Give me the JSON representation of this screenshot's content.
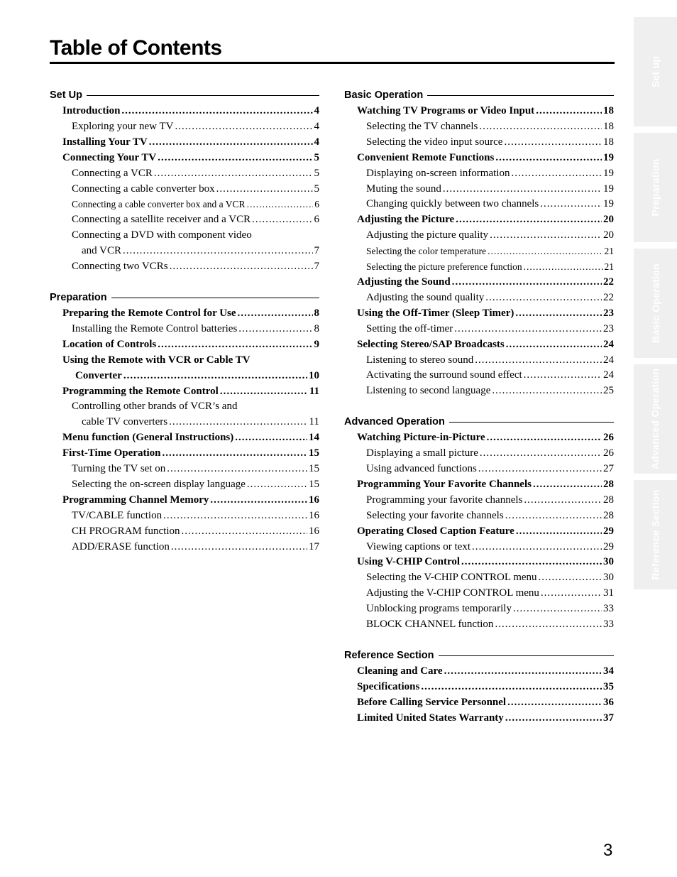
{
  "page": {
    "title": "Table of Contents",
    "page_number": "3"
  },
  "side_tabs": [
    {
      "label": "Set up"
    },
    {
      "label": "Preparation"
    },
    {
      "label": "Basic Operation"
    },
    {
      "label": "Advanced Operation"
    },
    {
      "label": "Reference Section"
    }
  ],
  "columns": [
    {
      "sections": [
        {
          "title": "Set Up",
          "entries": [
            {
              "level": 1,
              "label": "Introduction",
              "page": "4"
            },
            {
              "level": 2,
              "label": "Exploring your new TV",
              "page": "4"
            },
            {
              "level": 1,
              "label": "Installing Your TV",
              "page": "4"
            },
            {
              "level": 1,
              "label": "Connecting Your TV",
              "page": "5"
            },
            {
              "level": 2,
              "label": "Connecting a VCR",
              "page": "5"
            },
            {
              "level": 2,
              "label": "Connecting a cable converter box",
              "page": "5"
            },
            {
              "level": 2,
              "small": true,
              "label": "Connecting a cable converter box and a VCR",
              "page": "6"
            },
            {
              "level": 2,
              "label": "Connecting a satellite receiver and a VCR",
              "page": "6"
            },
            {
              "level": 2,
              "label": "Connecting a DVD with component video",
              "page": ""
            },
            {
              "level": 2,
              "cont": true,
              "label": "and VCR",
              "page": "7"
            },
            {
              "level": 2,
              "label": "Connecting two VCRs",
              "page": "7"
            }
          ]
        },
        {
          "title": "Preparation",
          "entries": [
            {
              "level": 1,
              "label": "Preparing the Remote Control for Use",
              "page": "8"
            },
            {
              "level": 2,
              "label": "Installing the Remote Control batteries",
              "page": "8"
            },
            {
              "level": 1,
              "label": "Location of Controls",
              "page": "9"
            },
            {
              "level": 1,
              "label": "Using the Remote with VCR or Cable TV",
              "page": ""
            },
            {
              "level": 1,
              "cont": true,
              "label": "Converter",
              "page": "10"
            },
            {
              "level": 1,
              "label": "Programming the Remote Control",
              "page": "11"
            },
            {
              "level": 2,
              "label": "Controlling other brands of VCR’s and",
              "page": ""
            },
            {
              "level": 2,
              "cont": true,
              "label": "cable TV converters",
              "page": "11"
            },
            {
              "level": 1,
              "label": "Menu function (General Instructions)",
              "page": "14"
            },
            {
              "level": 1,
              "label": "First-Time Operation",
              "page": "15"
            },
            {
              "level": 2,
              "label": "Turning the TV set on",
              "page": "15"
            },
            {
              "level": 2,
              "label": "Selecting the on-screen display language",
              "page": "15"
            },
            {
              "level": 1,
              "label": "Programming Channel Memory",
              "page": "16"
            },
            {
              "level": 2,
              "label": "TV/CABLE function",
              "page": "16"
            },
            {
              "level": 2,
              "label": "CH PROGRAM function",
              "page": "16"
            },
            {
              "level": 2,
              "label": "ADD/ERASE function",
              "page": "17"
            }
          ]
        }
      ]
    },
    {
      "sections": [
        {
          "title": "Basic Operation",
          "entries": [
            {
              "level": 1,
              "label": "Watching TV Programs or Video Input",
              "page": "18"
            },
            {
              "level": 2,
              "label": "Selecting the TV channels",
              "page": "18"
            },
            {
              "level": 2,
              "label": "Selecting the video input source",
              "page": "18"
            },
            {
              "level": 1,
              "label": "Convenient Remote Functions",
              "page": "19"
            },
            {
              "level": 2,
              "label": "Displaying on-screen information",
              "page": "19"
            },
            {
              "level": 2,
              "label": "Muting the sound",
              "page": "19"
            },
            {
              "level": 2,
              "label": "Changing quickly between two channels",
              "page": "19"
            },
            {
              "level": 1,
              "label": "Adjusting the Picture",
              "page": "20"
            },
            {
              "level": 2,
              "label": "Adjusting the picture quality",
              "page": "20"
            },
            {
              "level": 2,
              "small": true,
              "label": "Selecting the color temperature",
              "page": "21"
            },
            {
              "level": 2,
              "small": true,
              "label": "Selecting the picture preference function",
              "page": "21"
            },
            {
              "level": 1,
              "label": "Adjusting the Sound",
              "page": "22"
            },
            {
              "level": 2,
              "label": "Adjusting the sound quality",
              "page": "22"
            },
            {
              "level": 1,
              "label": "Using the Off-Timer (Sleep Timer)",
              "page": "23"
            },
            {
              "level": 2,
              "label": "Setting the off-timer",
              "page": "23"
            },
            {
              "level": 1,
              "label": "Selecting Stereo/SAP Broadcasts",
              "page": "24"
            },
            {
              "level": 2,
              "label": "Listening to stereo sound",
              "page": "24"
            },
            {
              "level": 2,
              "label": "Activating the surround sound effect",
              "page": "24"
            },
            {
              "level": 2,
              "label": "Listening to second language",
              "page": "25"
            }
          ]
        },
        {
          "title": "Advanced Operation",
          "entries": [
            {
              "level": 1,
              "label": "Watching Picture-in-Picture",
              "page": "26"
            },
            {
              "level": 2,
              "label": "Displaying a small picture",
              "page": "26"
            },
            {
              "level": 2,
              "label": "Using advanced functions",
              "page": "27"
            },
            {
              "level": 1,
              "label": "Programming Your Favorite Channels",
              "page": "28"
            },
            {
              "level": 2,
              "label": "Programming your favorite channels",
              "page": "28"
            },
            {
              "level": 2,
              "label": "Selecting your favorite channels",
              "page": "28"
            },
            {
              "level": 1,
              "label": "Operating Closed Caption Feature",
              "page": "29"
            },
            {
              "level": 2,
              "label": "Viewing captions or text",
              "page": "29"
            },
            {
              "level": 1,
              "label": "Using V-CHIP Control",
              "page": "30"
            },
            {
              "level": 2,
              "label": "Selecting the V-CHIP CONTROL menu",
              "page": "30"
            },
            {
              "level": 2,
              "label": "Adjusting the V-CHIP CONTROL menu",
              "page": "31"
            },
            {
              "level": 2,
              "label": "Unblocking programs temporarily",
              "page": "33"
            },
            {
              "level": 2,
              "label": "BLOCK CHANNEL function",
              "page": "33"
            }
          ]
        },
        {
          "title": "Reference Section",
          "entries": [
            {
              "level": 1,
              "label": "Cleaning and Care",
              "page": "34"
            },
            {
              "level": 1,
              "label": "Specifications",
              "page": "35"
            },
            {
              "level": 1,
              "label": "Before Calling Service Personnel",
              "page": "36"
            },
            {
              "level": 1,
              "label": "Limited United States Warranty",
              "page": "37"
            }
          ]
        }
      ]
    }
  ]
}
